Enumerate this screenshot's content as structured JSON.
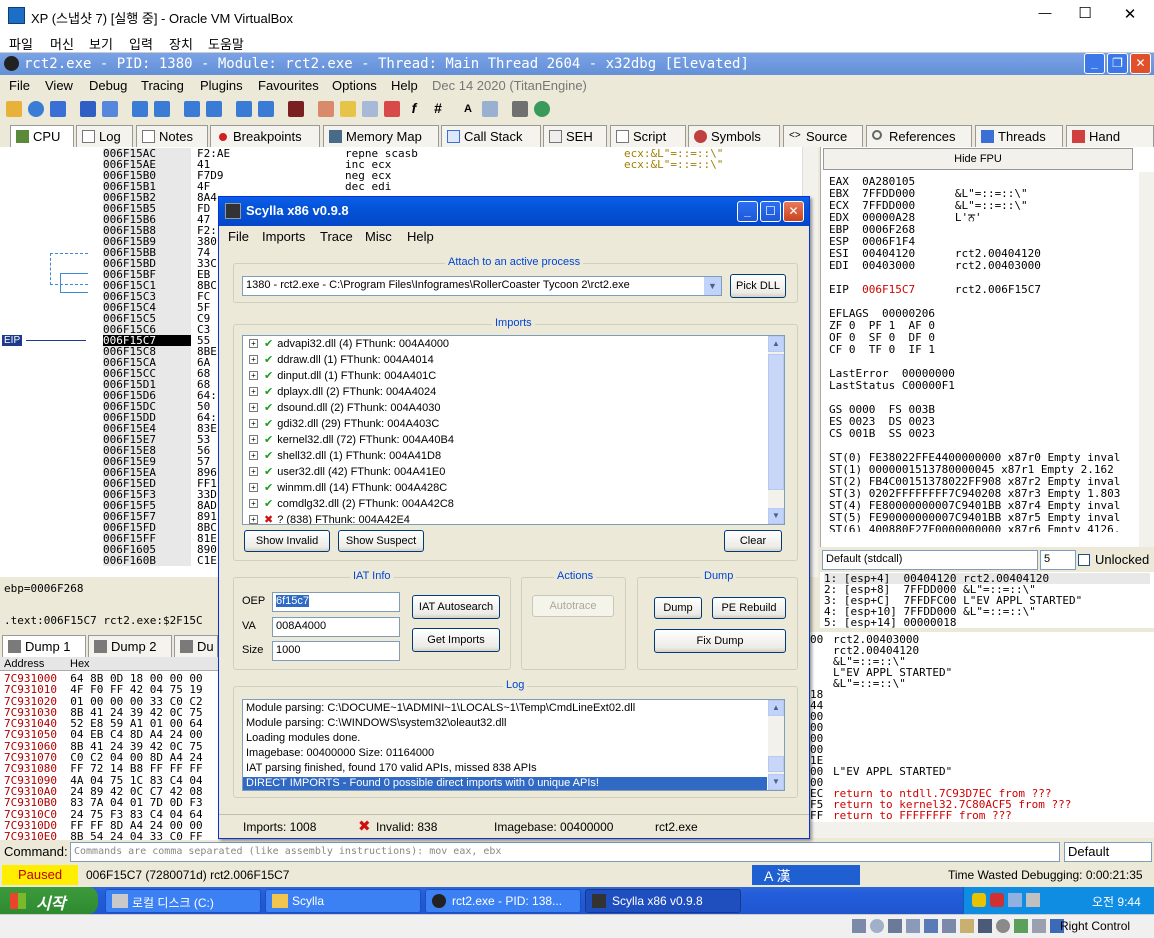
{
  "host": {
    "title": "XP (스냅샷 7) [실행 중] - Oracle VM VirtualBox",
    "menu": [
      "파일",
      "머신",
      "보기",
      "입력",
      "장치",
      "도움말"
    ],
    "minimize": "—",
    "maximize": "☐",
    "close": "✕",
    "right_control": "Right Control"
  },
  "dbg": {
    "title": "rct2.exe - PID: 1380 - Module: rct2.exe - Thread: Main Thread 2604 - x32dbg [Elevated]",
    "menu": [
      "File",
      "View",
      "Debug",
      "Tracing",
      "Plugins",
      "Favourites",
      "Options",
      "Help"
    ],
    "build": "Dec 14 2020 (TitanEngine)",
    "tabs": [
      "CPU",
      "Log",
      "Notes",
      "Breakpoints",
      "Memory Map",
      "Call Stack",
      "SEH",
      "Script",
      "Symbols",
      "Source",
      "References",
      "Threads",
      "Hand"
    ],
    "disasm_addrs": [
      "006F15AC",
      "006F15AE",
      "006F15B0",
      "006F15B1",
      "006F15B2",
      "006F15B5",
      "006F15B6",
      "006F15B8",
      "006F15B9",
      "006F15BB",
      "006F15BD",
      "006F15BF",
      "006F15C1",
      "006F15C3",
      "006F15C4",
      "006F15C5",
      "006F15C6",
      "006F15C7",
      "006F15C8",
      "006F15CA",
      "006F15CC",
      "006F15D1",
      "006F15D6",
      "006F15DC",
      "006F15DD",
      "006F15E4",
      "006F15E7",
      "006F15E8",
      "006F15E9",
      "006F15EA",
      "006F15ED",
      "006F15F3",
      "006F15F5",
      "006F15F7",
      "006F15FD",
      "006F15FF",
      "006F1605",
      "006F160B"
    ],
    "disasm_bytes": [
      "F2:AE",
      "41",
      "F7D9",
      "4F",
      "8A4",
      "FD",
      "47",
      "F2:",
      "380",
      "74",
      "33C",
      "EB",
      "8BC",
      "FC",
      "5F",
      "C9",
      "C3",
      "55",
      "8BE",
      "6A",
      "68",
      "68",
      "64:",
      "50",
      "64:",
      "83E",
      "53",
      "56",
      "57",
      "896",
      "FF1",
      "33D",
      "8AD",
      "891",
      "8BC",
      "81E",
      "890",
      "C1E"
    ],
    "disasm_instr": [
      "repne scasb",
      "inc ecx",
      "neg ecx",
      "dec edi"
    ],
    "disasm_comments": [
      "ecx:&L\"=::=::\\\"",
      "ecx:&L\"=::=::\\\""
    ],
    "eip_label": "EIP",
    "ebp_line": "ebp=0006F268",
    "text_line": ".text:006F15C7 rct2.exe:$2F15C",
    "hide_fpu": "Hide FPU",
    "regs": [
      "EAX  0A280105",
      "EBX  7FFDD000      &L\"=::=::\\\"",
      "ECX  7FFDD000      &L\"=::=::\\\"",
      "EDX  00000A28      L'ਨ'",
      "EBP  0006F268",
      "ESP  0006F1F4",
      "ESI  00404120      rct2.00404120",
      "EDI  00403000      rct2.00403000",
      "",
      "EIP  006F15C7      rct2.006F15C7",
      "",
      "EFLAGS  00000206",
      "ZF 0  PF 1  AF 0",
      "OF 0  SF 0  DF 0",
      "CF 0  TF 0  IF 1",
      "",
      "LastError  00000000",
      "LastStatus C00000F1",
      "",
      "GS 0000  FS 003B",
      "ES 0023  DS 0023",
      "CS 001B  SS 0023",
      "",
      "ST(0) FE38022FFE4400000000 x87r0 Empty inval",
      "ST(1) 0000001513780000045 x87r1 Empty 2.162",
      "ST(2) FB4C00151378022FF908 x87r2 Empty inval",
      "ST(3) 0202FFFFFFFF7C940208 x87r3 Empty 1.803",
      "ST(4) FE80000000007C9401BB x87r4 Empty inval",
      "ST(5) FE90000000007C9401BB x87r5 Empty inval",
      "ST(6) 400880F27F0000000000 x87r6 Empty 4126."
    ],
    "callconv": "Default (stdcall)",
    "argcount": "5",
    "unlocked": "Unlocked",
    "args": [
      "1: [esp+4]  00404120 rct2.00404120",
      "2: [esp+8]  7FFDD000 &L\"=::=::\\\"",
      "3: [esp+C]  7FFDFC00 L\"EV_APPL_STARTED\"",
      "4: [esp+10] 7FFDD000 &L\"=::=::\\\"",
      "5: [esp+14] 00000018"
    ],
    "stack": [
      "rct2.00403000",
      "rct2.00404120",
      "&L\"=::=::\\\"",
      "L\"EV_APPL_STARTED\"",
      "&L\"=::=::\\\"",
      "",
      "",
      "",
      "",
      "",
      "",
      "",
      "L\"EV_APPL_STARTED\"",
      "",
      "return to ntdll.7C93D7EC from ???",
      "return to kernel32.7C80ACF5 from ???",
      "return to FFFFFFFF from ???"
    ],
    "stack_left": [
      "00",
      "",
      "",
      "",
      "",
      "18",
      "44",
      "00",
      "00",
      "00",
      "00",
      "1E",
      "00",
      "00",
      "EC",
      "F5",
      "FF"
    ],
    "dump_tabs": [
      "Dump 1",
      "Dump 2",
      "Du"
    ],
    "dump_header_addr": "Address",
    "dump_header_hex": "Hex",
    "dump_rows": [
      [
        "7C931000",
        "64 8B 0D 18 00 00 00"
      ],
      [
        "7C931010",
        "4F F0 FF 42 04 75 19"
      ],
      [
        "7C931020",
        "01 00 00 00 33 C0 C2"
      ],
      [
        "7C931030",
        "8B 41 24 39 42 0C 75"
      ],
      [
        "7C931040",
        "52 E8 59 A1 01 00 64"
      ],
      [
        "7C931050",
        "04 EB C4 8D A4 24 00"
      ],
      [
        "7C931060",
        "8B 41 24 39 42 0C 75"
      ],
      [
        "7C931070",
        "C0 C2 04 00 8D A4 24"
      ],
      [
        "7C931080",
        "FF 72 14 B8 FF FF FF"
      ],
      [
        "7C931090",
        "4A 04 75 1C 83 C4 04"
      ],
      [
        "7C9310A0",
        "24 89 42 0C C7 42 08"
      ],
      [
        "7C9310B0",
        "83 7A 04 01 7D 0D F3"
      ],
      [
        "7C9310C0",
        "24 75 F3 83 C4 04 64"
      ],
      [
        "7C9310D0",
        "FF FF 8D A4 24 00 00"
      ],
      [
        "7C9310E0",
        "8B 54 24 04 33 C0 FF"
      ]
    ],
    "command_label": "Command:",
    "command_placeholder": "Commands are comma separated (like assembly instructions): mov eax, ebx",
    "command_mode": "Default",
    "paused": "Paused",
    "status_addr": "006F15C7 (7280071d) rct2.006F15C7",
    "time_wasted": "Time Wasted Debugging: 0:00:21:35"
  },
  "scylla": {
    "title": "Scylla x86 v0.9.8",
    "menu": [
      "File",
      "Imports",
      "Trace",
      "Misc",
      "Help"
    ],
    "attach_group": "Attach to an active process",
    "process": "1380 - rct2.exe - C:\\Program Files\\Infogrames\\RollerCoaster Tycoon 2\\rct2.exe",
    "pick_dll": "Pick DLL",
    "imports_group": "Imports",
    "imports": [
      {
        "ok": true,
        "text": "advapi32.dll (4) FThunk: 004A4000"
      },
      {
        "ok": true,
        "text": "ddraw.dll (1) FThunk: 004A4014"
      },
      {
        "ok": true,
        "text": "dinput.dll (1) FThunk: 004A401C"
      },
      {
        "ok": true,
        "text": "dplayx.dll (2) FThunk: 004A4024"
      },
      {
        "ok": true,
        "text": "dsound.dll (2) FThunk: 004A4030"
      },
      {
        "ok": true,
        "text": "gdi32.dll (29) FThunk: 004A403C"
      },
      {
        "ok": true,
        "text": "kernel32.dll (72) FThunk: 004A40B4"
      },
      {
        "ok": true,
        "text": "shell32.dll (1) FThunk: 004A41D8"
      },
      {
        "ok": true,
        "text": "user32.dll (42) FThunk: 004A41E0"
      },
      {
        "ok": true,
        "text": "winmm.dll (14) FThunk: 004A428C"
      },
      {
        "ok": true,
        "text": "comdlg32.dll (2) FThunk: 004A42C8"
      },
      {
        "ok": false,
        "text": "? (838) FThunk: 004A42E4"
      }
    ],
    "show_invalid": "Show Invalid",
    "show_suspect": "Show Suspect",
    "clear": "Clear",
    "iat_group": "IAT Info",
    "oep_label": "OEP",
    "oep": "6f15c7",
    "va_label": "VA",
    "va": "008A4000",
    "size_label": "Size",
    "size": "1000",
    "iat_autosearch": "IAT Autosearch",
    "get_imports": "Get Imports",
    "actions_group": "Actions",
    "autotrace": "Autotrace",
    "dump_group": "Dump",
    "dump": "Dump",
    "pe_rebuild": "PE Rebuild",
    "fix_dump": "Fix Dump",
    "log_group": "Log",
    "log": [
      "Module parsing: C:\\DOCUME~1\\ADMINI~1\\LOCALS~1\\Temp\\CmdLineExt02.dll",
      "Module parsing: C:\\WINDOWS\\system32\\oleaut32.dll",
      "Loading modules done.",
      "Imagebase: 00400000 Size: 01164000",
      "IAT parsing finished, found 170 valid APIs, missed 838 APIs",
      "DIRECT IMPORTS - Found 0 possible direct imports with 0 unique APIs!"
    ],
    "status_imports": "Imports: 1008",
    "status_invalid": "Invalid: 838",
    "status_imagebase": "Imagebase: 00400000",
    "status_module": "rct2.exe"
  },
  "taskbar": {
    "start": "시작",
    "items": [
      "로컬 디스크 (C:)",
      "Scylla",
      "rct2.exe - PID: 138...",
      "Scylla x86 v0.9.8"
    ],
    "clock": "오전 9:44",
    "ime": "A 漢"
  }
}
